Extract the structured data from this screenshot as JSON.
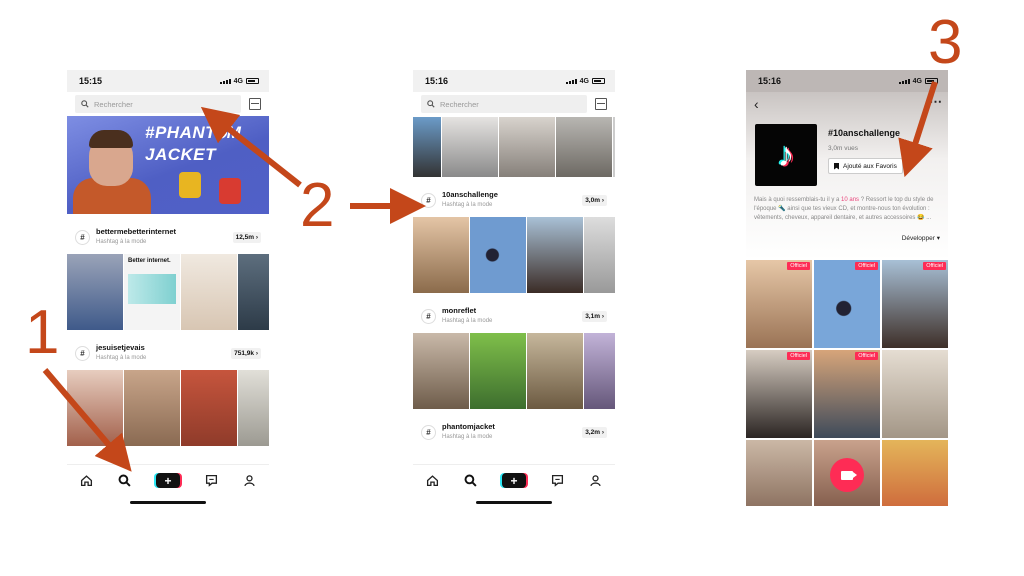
{
  "status_bar": {
    "time_left": "15:15",
    "time_center": "15:16",
    "time_right": "15:16",
    "network": "4G"
  },
  "search": {
    "placeholder": "Rechercher"
  },
  "banner": {
    "title_line1": "#PHANT⌀M",
    "title_line2": "JACKET"
  },
  "screen1_tags": [
    {
      "name": "bettermebetterinternet",
      "subtitle": "Hashtag à la mode",
      "count": "12,5m"
    },
    {
      "name": "jesuisetjevais",
      "subtitle": "Hashtag à la mode",
      "count": "751,9k"
    }
  ],
  "screen1_thumb_text": "Better internet.",
  "screen2_tags": [
    {
      "name": "10anschallenge",
      "subtitle": "Hashtag à la mode",
      "count": "3,0m"
    },
    {
      "name": "monreflet",
      "subtitle": "Hashtag à la mode",
      "count": "3,1m"
    },
    {
      "name": "phantomjacket",
      "subtitle": "Hashtag à la mode",
      "count": "3,2m"
    }
  ],
  "hashtag_page": {
    "title": "#10anschallenge",
    "views": "3,0m vues",
    "fav_button": "Ajouté aux Favoris",
    "desc_pre": "Mais à quoi ressemblais-tu il y a ",
    "desc_highlight": "10 ans",
    "desc_post": " ? Ressort le top du style de l'époque 🔦 ainsi que tes vieux CD, et montre-nous ton évolution : vêtements, cheveux, appareil dentaire, et autres accessoires 😂 ...",
    "expand": "Développer ▾",
    "badge": "Officiel"
  },
  "annotations": {
    "step1": "1",
    "step2": "2",
    "step3": "3"
  },
  "colors": {
    "accent_red": "#fe2c55",
    "accent_cyan": "#25f4ee",
    "annotation": "#c4471a"
  },
  "icons": [
    "search-icon",
    "scan-icon",
    "home-icon",
    "plus-icon",
    "inbox-icon",
    "profile-icon",
    "back-icon",
    "more-icon",
    "bookmark-icon",
    "camera-icon"
  ]
}
